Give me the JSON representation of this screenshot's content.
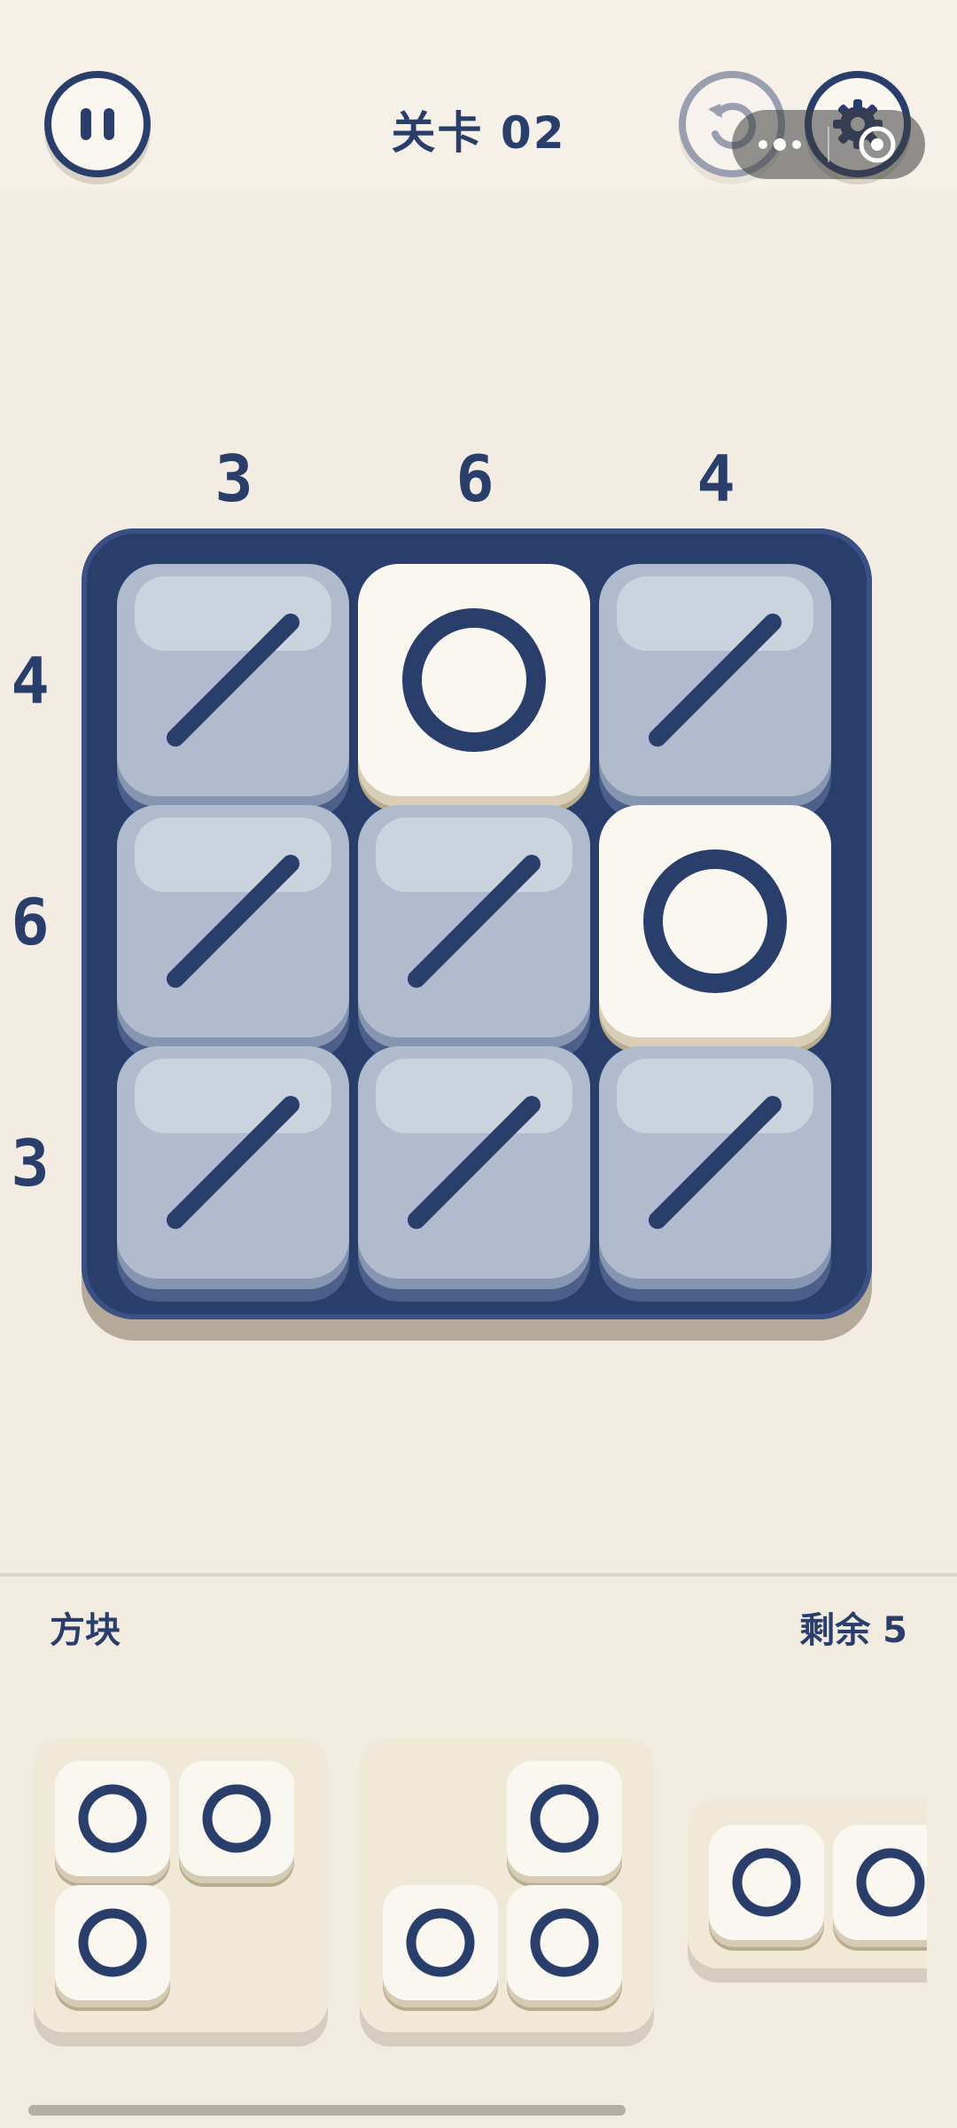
{
  "header": {
    "level_label": "关卡 02",
    "pause_icon": "pause-icon",
    "undo_icon": "undo-icon",
    "settings_icon": "gear-icon"
  },
  "board": {
    "column_clues": [
      "3",
      "6",
      "4"
    ],
    "row_clues": [
      "4",
      "6",
      "3"
    ],
    "tiles": [
      [
        "slash",
        "ring",
        "slash"
      ],
      [
        "slash",
        "slash",
        "ring"
      ],
      [
        "slash",
        "slash",
        "slash"
      ]
    ]
  },
  "tray": {
    "title": "方块",
    "remaining": "剩余 5"
  },
  "colors": {
    "navy": "#2a3e6c",
    "background": "#f2ece2",
    "tile_blue": "#b0bccd",
    "tile_cream": "#faf7f1"
  }
}
